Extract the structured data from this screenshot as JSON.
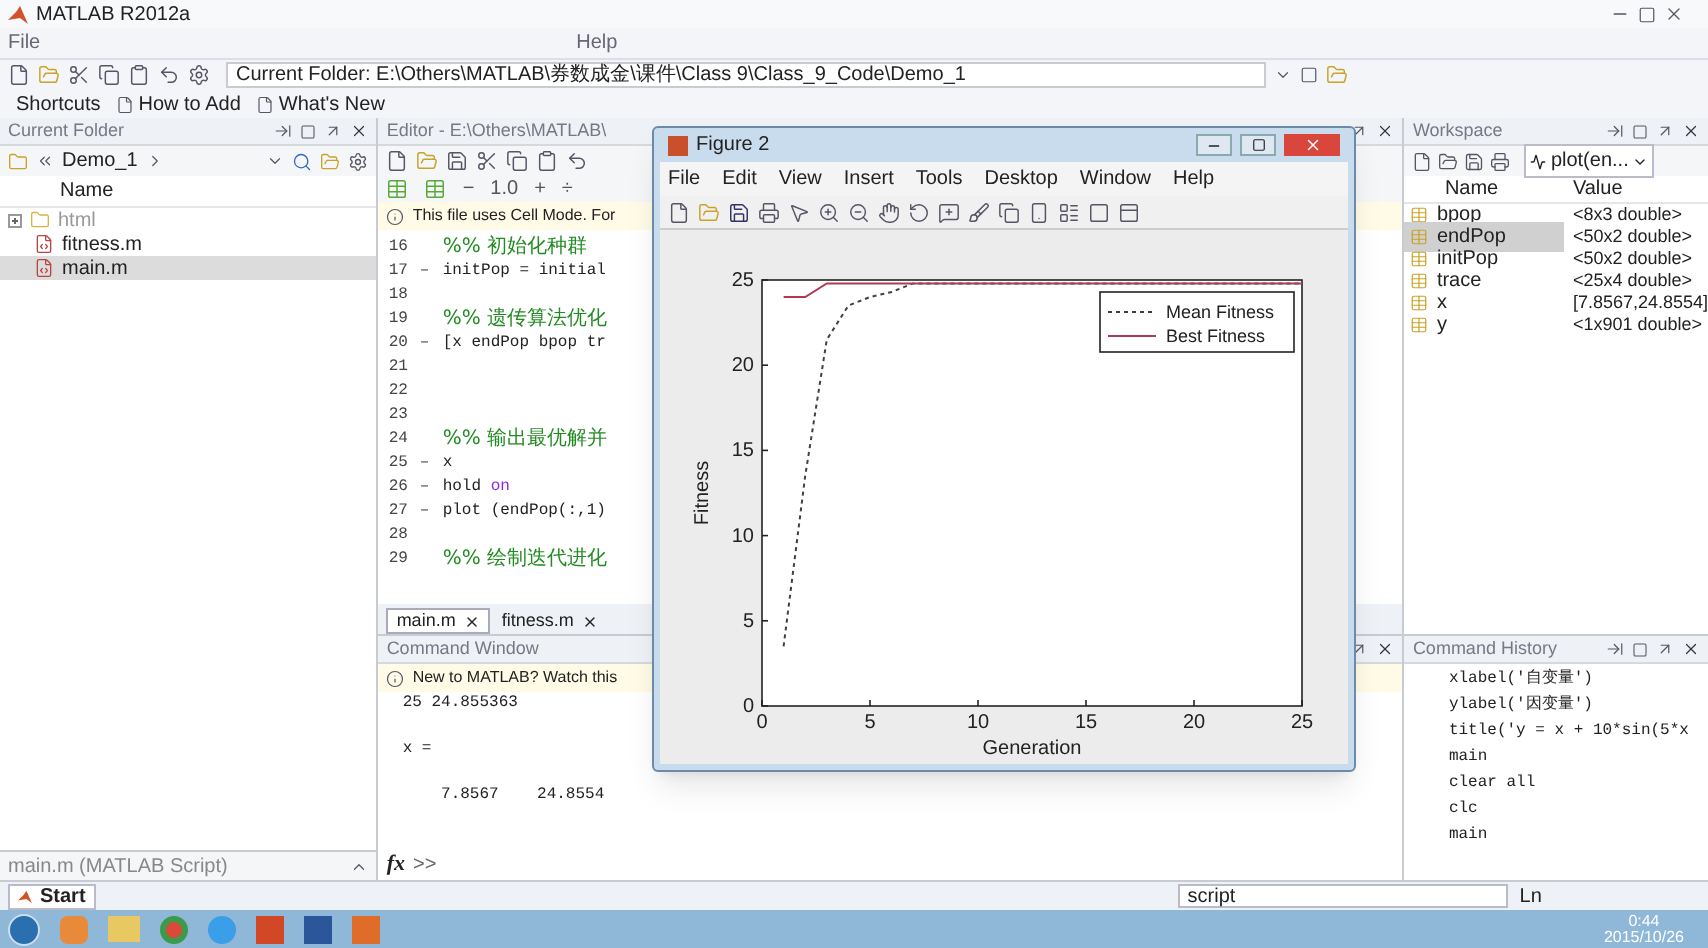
{
  "app_window": {
    "title": "MATLAB R2012a"
  },
  "menu": [
    "File",
    "Help"
  ],
  "toolbar": {
    "current_folder": "Current Folder: E:\\Others\\MATLAB\\券数成金\\课件\\Class 9\\Class_9_Code\\Demo_1"
  },
  "shortcuts": {
    "label": "Shortcuts",
    "items": [
      "How to Add",
      "What's New"
    ]
  },
  "current_folder": {
    "title": "Current Folder",
    "path": "Demo_1",
    "column": "Name",
    "files": [
      {
        "name": "html",
        "kind": "folder",
        "expanded": false,
        "selected": false
      },
      {
        "name": "fitness.m",
        "kind": "mfile",
        "selected": false
      },
      {
        "name": "main.m",
        "kind": "mfile",
        "selected": true
      }
    ],
    "details": "main.m (MATLAB Script)"
  },
  "editor": {
    "title": "Editor - E:\\Others\\MATLAB\\",
    "spacing_controls": [
      "−",
      "1.0",
      "+",
      "÷"
    ],
    "notice": "This file uses Cell Mode. For",
    "lines": [
      {
        "number": "16",
        "kind": "cell",
        "text": "%% 初始化种群"
      },
      {
        "number": "17",
        "marker": "–",
        "kind": "code",
        "text": "initPop = initial"
      },
      {
        "number": "18",
        "kind": "blank"
      },
      {
        "number": "19",
        "kind": "cell",
        "text": "%% 遗传算法优化"
      },
      {
        "number": "20",
        "marker": "–",
        "kind": "code",
        "text": "[x endPop bpop tr"
      },
      {
        "number": "21",
        "kind": "blank"
      },
      {
        "number": "22",
        "kind": "blank"
      },
      {
        "number": "23",
        "kind": "blank"
      },
      {
        "number": "24",
        "kind": "cell",
        "text": "%% 输出最优解并"
      },
      {
        "number": "25",
        "marker": "–",
        "kind": "code",
        "text": "x"
      },
      {
        "number": "26",
        "marker": "–",
        "kind": "code",
        "text": "hold ",
        "keyword": "on"
      },
      {
        "number": "27",
        "marker": "–",
        "kind": "code",
        "text": "plot (endPop(:,1)"
      },
      {
        "number": "28",
        "kind": "blank"
      },
      {
        "number": "29",
        "kind": "cell",
        "text": "%% 绘制迭代进化"
      }
    ],
    "tabs": [
      {
        "label": "main.m",
        "selected": true
      },
      {
        "label": "fitness.m",
        "selected": false
      }
    ]
  },
  "command_window": {
    "title": "Command Window",
    "notice": "New to MATLAB? Watch this",
    "output": [
      "25 24.855363",
      "x =",
      "    7.8567    24.8554"
    ],
    "prompt_icon": "fx",
    "prompt": ">>"
  },
  "figure": {
    "title": "Figure 2",
    "menu": [
      "File",
      "Edit",
      "View",
      "Insert",
      "Tools",
      "Desktop",
      "Window",
      "Help"
    ],
    "chart_data": {
      "type": "line",
      "xlabel": "Generation",
      "ylabel": "Fitness",
      "x": [
        1,
        2,
        3,
        4,
        5,
        6,
        7,
        8,
        9,
        10,
        11,
        12,
        13,
        14,
        15,
        16,
        17,
        18,
        19,
        20,
        21,
        22,
        23,
        24,
        25
      ],
      "series": [
        {
          "name": "Mean Fitness",
          "color": "#404040",
          "line_style": "dotted",
          "values": [
            3.5,
            13.5,
            21.5,
            23.5,
            24,
            24.3,
            24.8,
            24.8,
            24.8,
            24.8,
            24.8,
            24.8,
            24.8,
            24.8,
            24.8,
            24.8,
            24.8,
            24.8,
            24.8,
            24.8,
            24.8,
            24.8,
            24.8,
            24.8,
            24.8
          ]
        },
        {
          "name": "Best Fitness",
          "color": "#b03a55",
          "line_style": "solid",
          "values": [
            24,
            24,
            24.8,
            24.8,
            24.8,
            24.8,
            24.8,
            24.8,
            24.8,
            24.8,
            24.8,
            24.8,
            24.8,
            24.8,
            24.8,
            24.8,
            24.8,
            24.8,
            24.8,
            24.8,
            24.8,
            24.8,
            24.8,
            24.8,
            24.8
          ]
        }
      ],
      "legend": true,
      "xlim": [
        0,
        25
      ],
      "ylim": [
        0,
        25
      ],
      "xticks": [
        0,
        5,
        10,
        15,
        20,
        25
      ],
      "yticks": [
        0,
        5,
        10,
        15,
        20,
        25
      ]
    }
  },
  "workspace": {
    "title": "Workspace",
    "plot_selector": "plot(en...",
    "columns": [
      "Name",
      "Value"
    ],
    "variables": [
      {
        "name": "bpop",
        "value": "<8x3 double>",
        "selected": false
      },
      {
        "name": "endPop",
        "value": "<50x2 double>",
        "selected": true
      },
      {
        "name": "initPop",
        "value": "<50x2 double>",
        "selected": false
      },
      {
        "name": "trace",
        "value": "<25x4 double>",
        "selected": false
      },
      {
        "name": "x",
        "value": "[7.8567,24.8554]",
        "selected": false
      },
      {
        "name": "y",
        "value": "<1x901 double>",
        "selected": false
      }
    ]
  },
  "command_history": {
    "title": "Command History",
    "entries": [
      "xlabel('自变量')",
      "ylabel('因变量')",
      "title('y = x + 10*sin(5*x",
      "main",
      "clear all",
      "clc",
      "main"
    ]
  },
  "status_bar": {
    "start": "Start",
    "search": "script",
    "position": "Ln"
  },
  "taskbar": {
    "time": "0:44",
    "date": "2015/10/26"
  }
}
